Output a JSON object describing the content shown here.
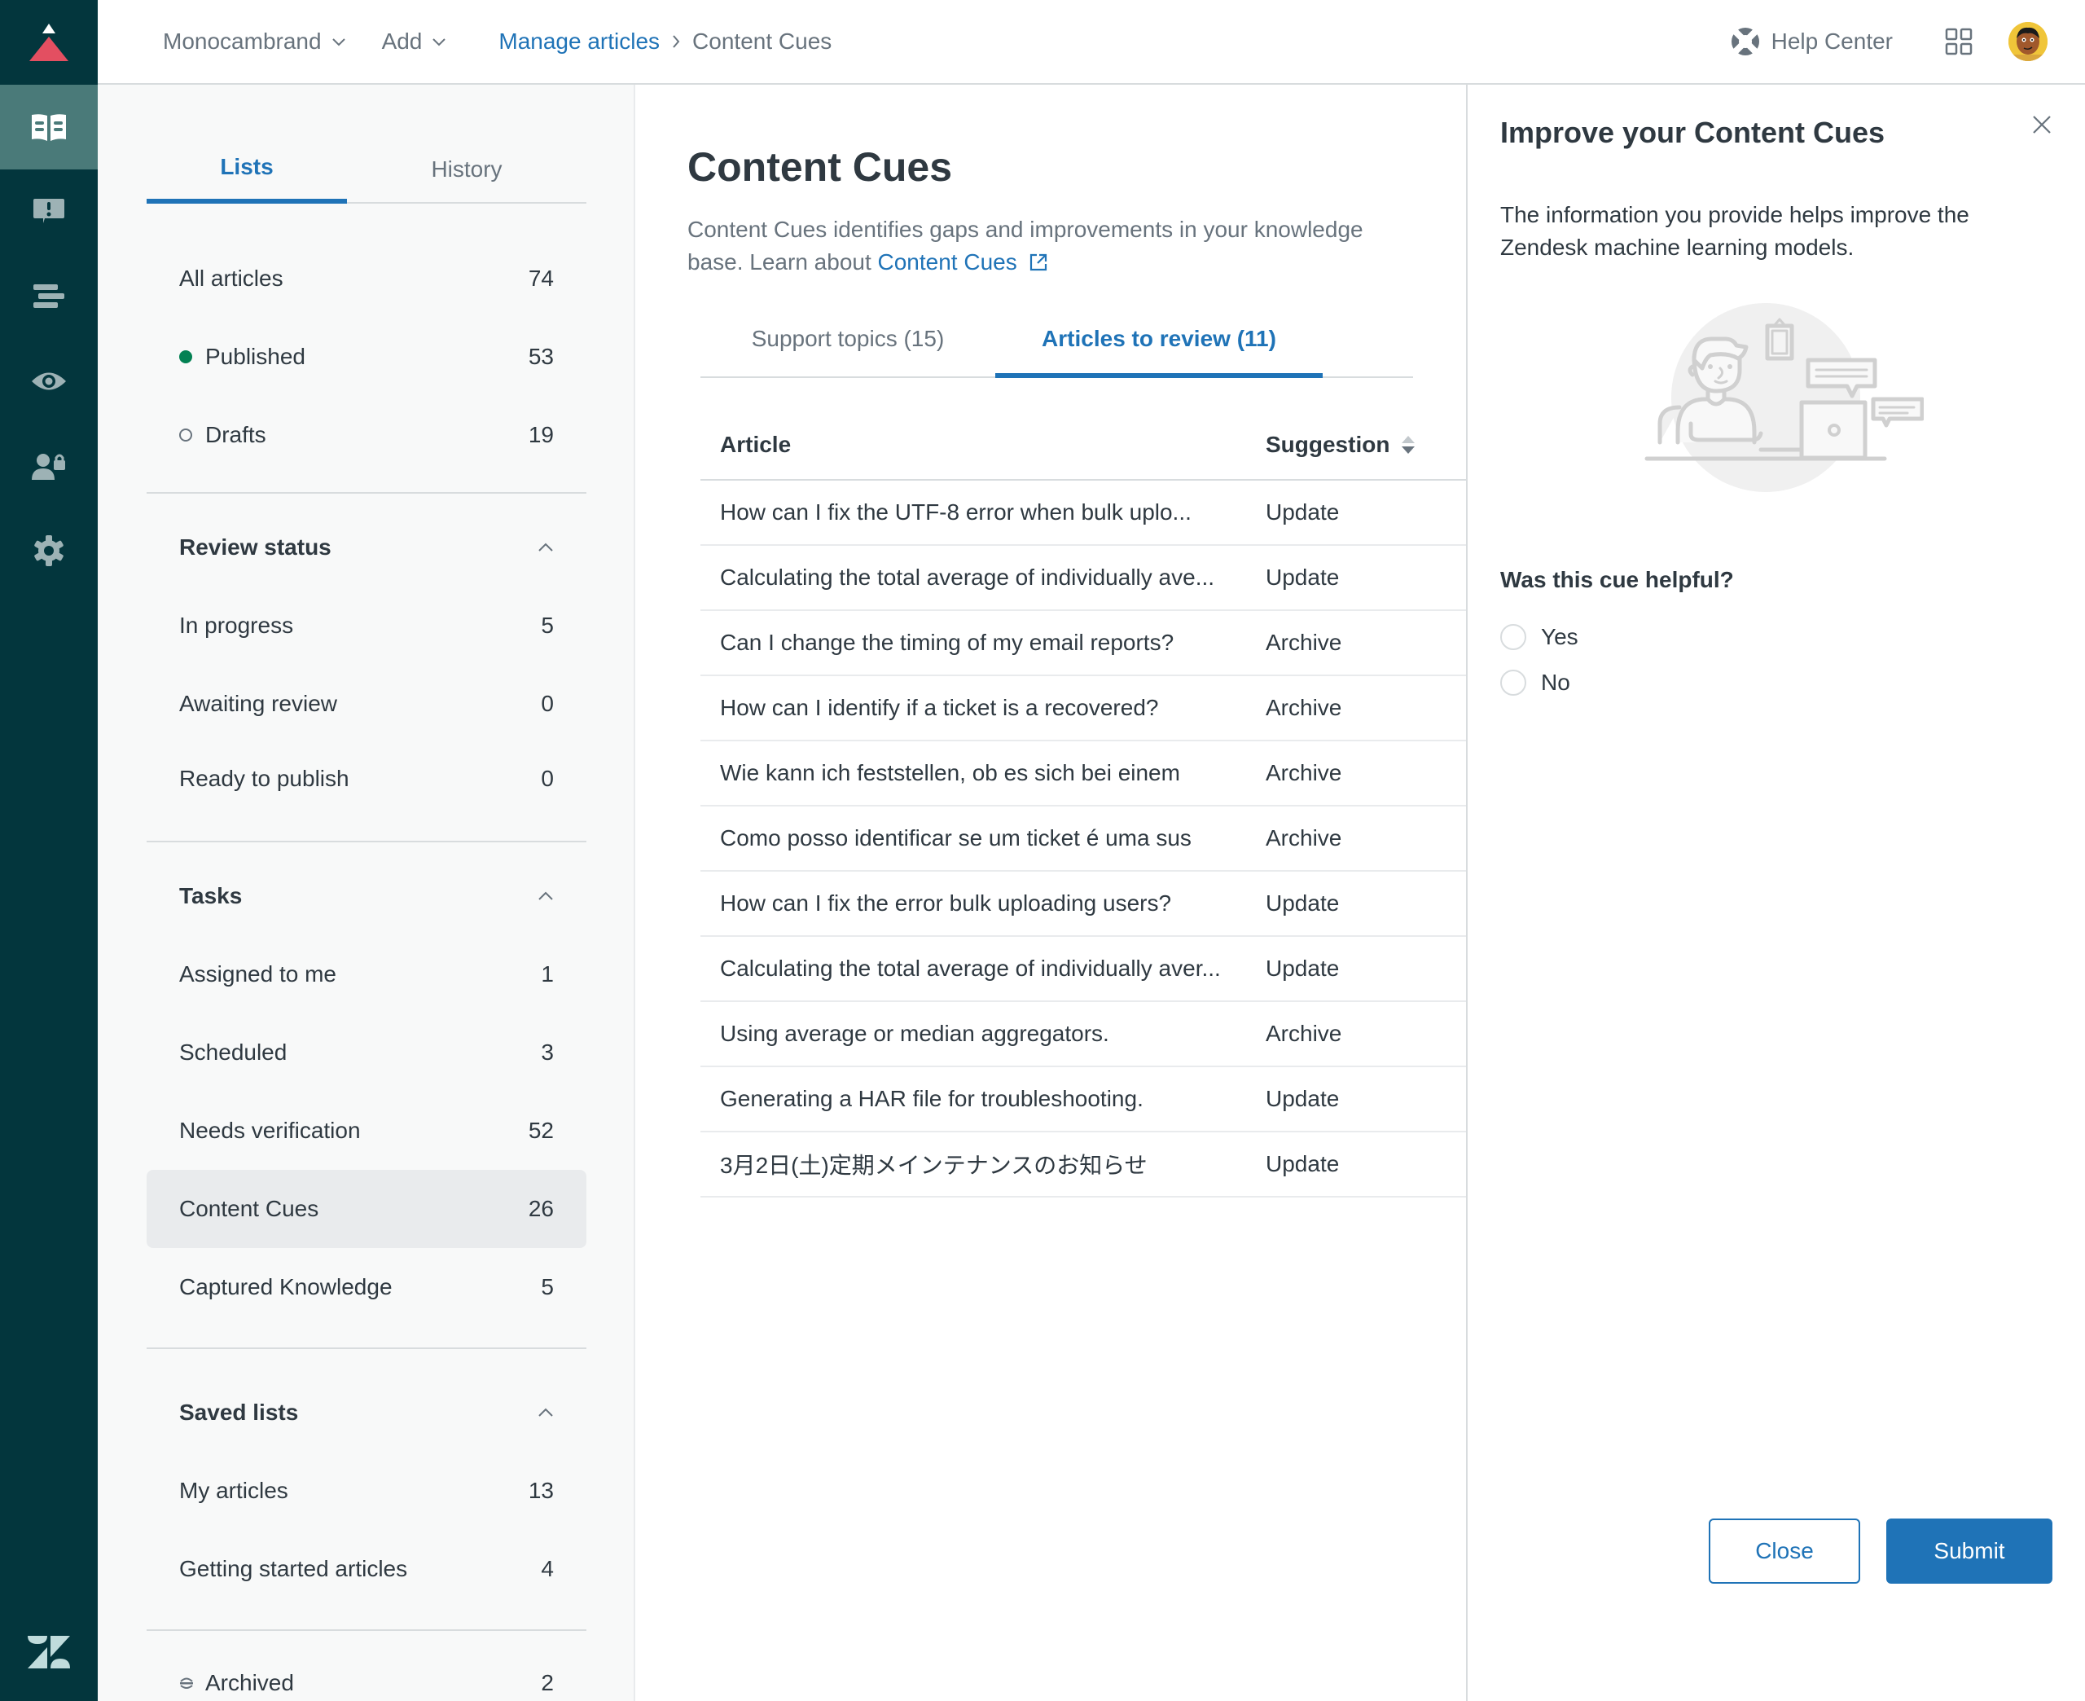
{
  "header": {
    "brand_menu": "Monocambrand",
    "add_menu": "Add",
    "breadcrumb": {
      "parent": "Manage articles",
      "current": "Content Cues"
    },
    "help_center": "Help Center"
  },
  "nav_rail": {
    "items": [
      {
        "icon": "book-icon",
        "active": true
      },
      {
        "icon": "alert-chat-icon",
        "active": false
      },
      {
        "icon": "align-lines-icon",
        "active": false
      },
      {
        "icon": "eye-icon",
        "active": false
      },
      {
        "icon": "user-lock-icon",
        "active": false
      },
      {
        "icon": "gear-icon",
        "active": false
      }
    ]
  },
  "sidebar": {
    "tabs": [
      "Lists",
      "History"
    ],
    "active_tab": "Lists",
    "top_items": [
      {
        "label": "All articles",
        "count": "74"
      },
      {
        "label": "Published",
        "count": "53",
        "status": "published"
      },
      {
        "label": "Drafts",
        "count": "19",
        "status": "draft"
      }
    ],
    "review_status": {
      "title": "Review status",
      "items": [
        {
          "label": "In progress",
          "count": "5"
        },
        {
          "label": "Awaiting review",
          "count": "0"
        },
        {
          "label": "Ready to publish",
          "count": "0"
        }
      ]
    },
    "tasks": {
      "title": "Tasks",
      "items": [
        {
          "label": "Assigned to me",
          "count": "1"
        },
        {
          "label": "Scheduled",
          "count": "3"
        },
        {
          "label": "Needs verification",
          "count": "52"
        },
        {
          "label": "Content Cues",
          "count": "26",
          "selected": true
        },
        {
          "label": "Captured Knowledge",
          "count": "5"
        }
      ]
    },
    "saved_lists": {
      "title": "Saved lists",
      "items": [
        {
          "label": "My articles",
          "count": "13"
        },
        {
          "label": "Getting started articles",
          "count": "4"
        }
      ]
    },
    "archived": {
      "label": "Archived",
      "count": "2"
    }
  },
  "main": {
    "title": "Content Cues",
    "description": "Content Cues identifies gaps and improvements in your knowledge base. Learn about ",
    "description_link": "Content Cues",
    "tabs": [
      {
        "label": "Support topics (15)",
        "active": false
      },
      {
        "label": "Articles to review (11)",
        "active": true
      }
    ],
    "table": {
      "columns": [
        "Article",
        "Suggestion"
      ],
      "rows": [
        {
          "article": "How can I fix the UTF-8 error when bulk uplo...",
          "suggestion": "Update"
        },
        {
          "article": "Calculating the total average of individually ave...",
          "suggestion": "Update"
        },
        {
          "article": "Can I change the timing of my email reports?",
          "suggestion": "Archive"
        },
        {
          "article": "How can I identify if a ticket is a recovered?",
          "suggestion": "Archive"
        },
        {
          "article": "Wie kann ich feststellen, ob es sich bei einem",
          "suggestion": "Archive"
        },
        {
          "article": "Como posso identificar se um ticket é uma sus",
          "suggestion": "Archive"
        },
        {
          "article": "How can I fix the error bulk uploading users?",
          "suggestion": "Update"
        },
        {
          "article": "Calculating the total average of individually aver...",
          "suggestion": "Update"
        },
        {
          "article": "Using average or median aggregators.",
          "suggestion": "Archive"
        },
        {
          "article": "Generating a HAR file for troubleshooting.",
          "suggestion": "Update"
        },
        {
          "article": "3月2日(土)定期メインテナンスのお知らせ",
          "suggestion": "Update"
        }
      ]
    }
  },
  "panel": {
    "title": "Improve your Content Cues",
    "description": "The information you provide helps improve the Zendesk machine learning models.",
    "question": "Was this cue helpful?",
    "options": [
      "Yes",
      "No"
    ],
    "close_label": "Close",
    "submit_label": "Submit"
  },
  "colors": {
    "rail_bg": "#03363d",
    "rail_active": "#4a7a79",
    "accent": "#1f73b7",
    "published": "#038153",
    "brand_red": "#e34f61"
  }
}
